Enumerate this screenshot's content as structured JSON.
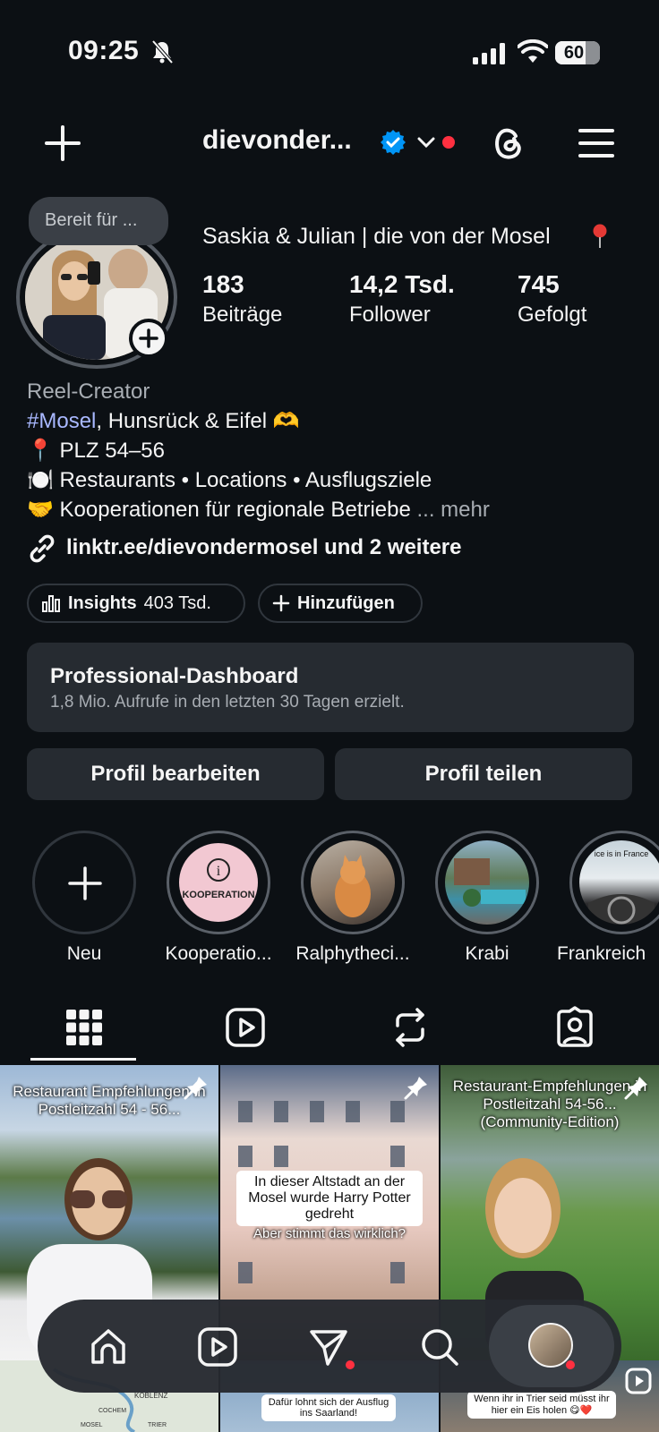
{
  "status_bar": {
    "time": "09:25",
    "battery": "60"
  },
  "header": {
    "username": "dievonder..."
  },
  "profile": {
    "note": "Bereit für ...",
    "display_name": "Saskia & Julian | die von der Mosel",
    "stats": [
      {
        "value": "183",
        "label": "Beiträge"
      },
      {
        "value": "14,2 Tsd.",
        "label": "Follower"
      },
      {
        "value": "745",
        "label": "Gefolgt"
      }
    ],
    "category": "Reel-Creator",
    "bio_hashtag": "#Mosel",
    "bio_line1_rest": ", Hunsrück & Eifel 🫶",
    "bio_line2": "📍 PLZ 54–56",
    "bio_line3": "🍽️ Restaurants • Locations • Ausflugsziele",
    "bio_line4": "🤝 Kooperationen für regionale Betriebe",
    "bio_more": "... mehr",
    "link": "linktr.ee/dievondermosel und 2 weitere"
  },
  "pills": {
    "insights_label": "Insights",
    "insights_value": "403 Tsd.",
    "add_label": "Hinzufügen"
  },
  "dashboard": {
    "title": "Professional-Dashboard",
    "subtitle": "1,8 Mio. Aufrufe in den letzten 30 Tagen erzielt."
  },
  "buttons": {
    "edit": "Profil bearbeiten",
    "share": "Profil teilen"
  },
  "highlights": [
    {
      "label": "Neu"
    },
    {
      "label": "Kooperatio...",
      "cover_text": "KOOPERATION"
    },
    {
      "label": "Ralphytheci..."
    },
    {
      "label": "Krabi"
    },
    {
      "label": "Frankreich",
      "cover_text": "ice is in France"
    }
  ],
  "grid": [
    {
      "caption": "Restaurant Empfehlungen in Postleitzahl 54 - 56..."
    },
    {
      "caption": "In dieser Altstadt an der Mosel wurde Harry Potter gedreht",
      "caption2": "Aber stimmt das wirklich?"
    },
    {
      "caption": "Restaurant-Empfehlungen in Postleitzahl 54-56... (Community-Edition)"
    },
    {
      "caption": ""
    },
    {
      "caption": "Dafür lohnt sich der Ausflug ins Saarland!"
    },
    {
      "caption": "Wenn ihr in Trier seid müsst ihr hier ein Eis holen 😋❤️"
    }
  ],
  "map_labels": [
    "KOBLENZ",
    "COCHEM",
    "MOSEL",
    "TRIER"
  ],
  "colors": {
    "background": "#0c1014",
    "accent_blue": "#0095f6",
    "notification_red": "#ff3040",
    "surface": "#262b31"
  }
}
